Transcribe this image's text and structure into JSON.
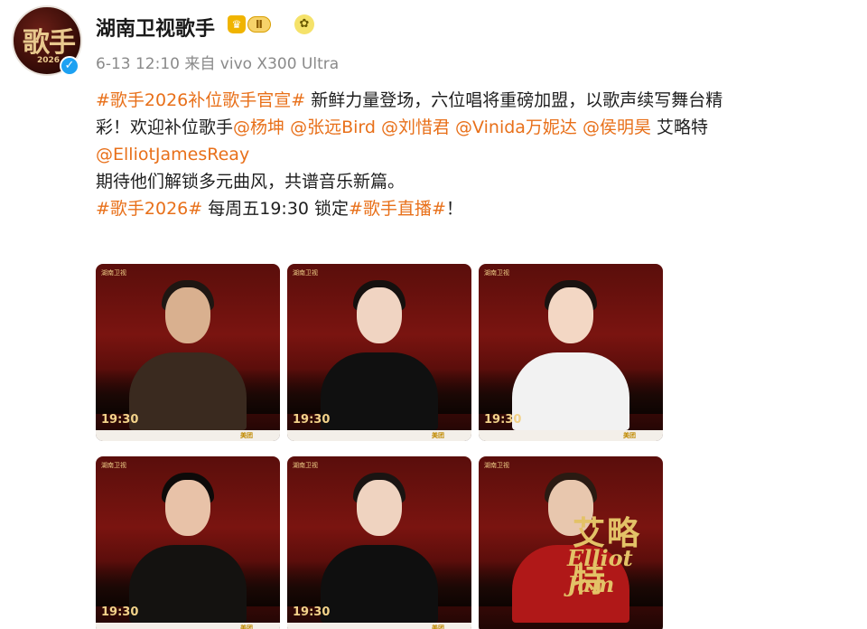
{
  "account": {
    "name": "湖南卫视歌手",
    "level": "Ⅱ",
    "avatar_text": "歌手",
    "avatar_year": "2026"
  },
  "post_meta": "6-13 12:10 来自 vivo X300 Ultra",
  "post": {
    "l1_tag": "#歌手2026补位歌手官宣#",
    "l1_text": " 新鲜力量登场，六位唱将重磅加盟，以歌声续写舞台精",
    "l2_text_a": "彩！欢迎补位歌手",
    "m1": "@杨坤",
    "m2": "@张远Bird",
    "m3": "@刘惜君",
    "m4": "@Vinida万妮达",
    "m5": "@侯明昊",
    "l2_text_b": " 艾略特",
    "m6": "@ElliotJamesReay",
    "l4_text": "期待他们解锁多元曲风，共谱音乐新篇。",
    "l5_tag1": "#歌手2026#",
    "l5_text": " 每周五19:30 锁定",
    "l5_tag2": "#歌手直播#",
    "l5_end": "！"
  },
  "images": [
    {
      "time": "19:30",
      "skin": "#d9b08f",
      "hair": "#1e1612",
      "body": "#3a2a1f"
    },
    {
      "time": "19:30",
      "skin": "#f0d4c2",
      "hair": "#15100e",
      "body": "#101010"
    },
    {
      "time": "19:30",
      "skin": "#f3d7c4",
      "hair": "#1a1210",
      "body": "#f2f2f2"
    },
    {
      "time": "19:30",
      "skin": "#e8c2a8",
      "hair": "#0d0a09",
      "body": "#141210"
    },
    {
      "time": "19:30",
      "skin": "#efd3c0",
      "hair": "#1a1412",
      "body": "#0f0f0f"
    },
    {
      "time": "",
      "skin": "#e8c7ae",
      "hair": "#2a1a12",
      "body": "#b01818",
      "title": "艾略特",
      "subtitle": "Elliot Jam"
    }
  ],
  "brand_tag": "湖南卫视",
  "footer_tag": "美团"
}
